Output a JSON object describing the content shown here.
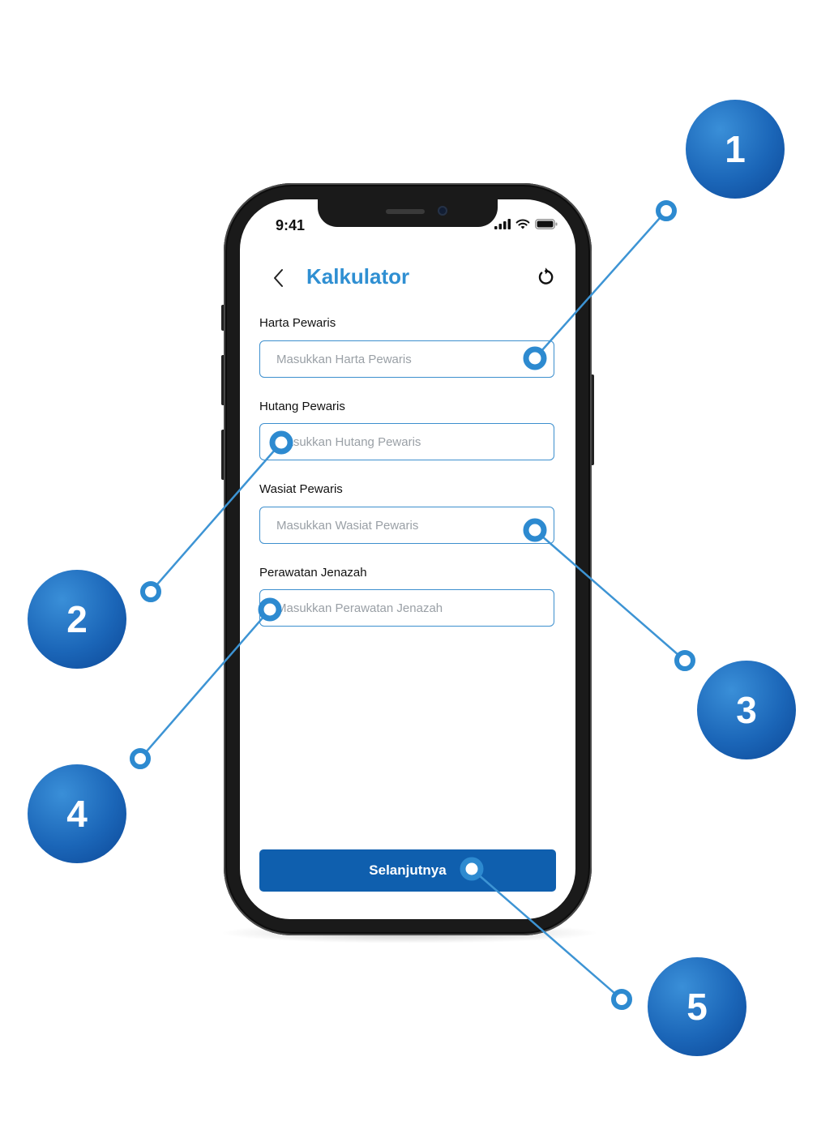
{
  "status_bar": {
    "time": "9:41"
  },
  "header": {
    "title": "Kalkulator"
  },
  "form": {
    "fields": [
      {
        "label": "Harta Pewaris",
        "placeholder": "Masukkan Harta Pewaris"
      },
      {
        "label": "Hutang Pewaris",
        "placeholder": "Masukkan Hutang Pewaris"
      },
      {
        "label": "Wasiat Pewaris",
        "placeholder": "Masukkan Wasiat Pewaris"
      },
      {
        "label": "Perawatan Jenazah",
        "placeholder": "Masukkan Perawatan Jenazah"
      }
    ],
    "submit_label": "Selanjutnya"
  },
  "annotations": {
    "markers": [
      "1",
      "2",
      "3",
      "4",
      "5"
    ]
  },
  "colors": {
    "accent": "#2f8fd2",
    "button": "#0f5fae",
    "callout_line": "#3d94d4"
  },
  "icons": {
    "back": "chevron-left-icon",
    "reset": "reset-icon",
    "signal": "signal-icon",
    "wifi": "wifi-icon",
    "battery": "battery-icon"
  }
}
